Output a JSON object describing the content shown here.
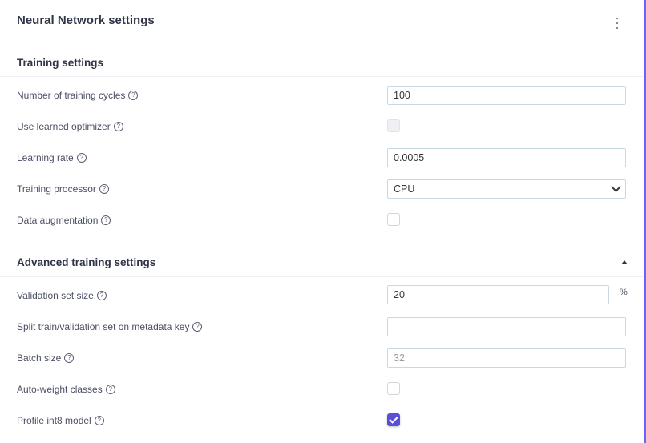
{
  "panel": {
    "title": "Neural Network settings",
    "menu_icon": "kebab-menu-icon"
  },
  "training_settings": {
    "title": "Training settings",
    "fields": [
      {
        "label": "Number of training cycles",
        "value": "100"
      },
      {
        "label": "Use learned optimizer",
        "checked": false,
        "disabled": true
      },
      {
        "label": "Learning rate",
        "value": "0.0005"
      },
      {
        "label": "Training processor",
        "value": "CPU"
      },
      {
        "label": "Data augmentation",
        "checked": false
      }
    ]
  },
  "advanced_settings": {
    "title": "Advanced training settings",
    "fields": [
      {
        "label": "Validation set size",
        "value": "20",
        "unit": "%"
      },
      {
        "label": "Split train/validation set on metadata key",
        "value": ""
      },
      {
        "label": "Batch size",
        "placeholder": "32"
      },
      {
        "label": "Auto-weight classes",
        "checked": false
      },
      {
        "label": "Profile int8 model",
        "checked": true
      }
    ]
  },
  "help_glyph": "?",
  "colors": {
    "accent": "#5b4fd8",
    "field_border": "#c9d9e4",
    "text": "#3b3b4f"
  }
}
